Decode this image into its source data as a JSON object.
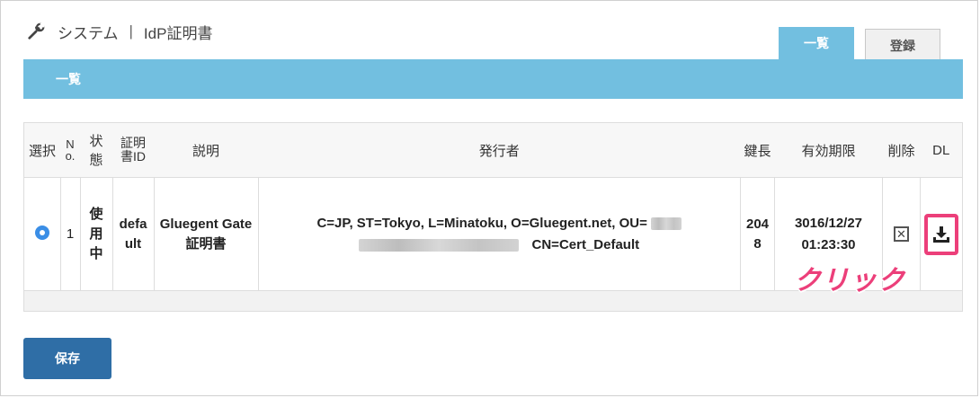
{
  "header": {
    "section": "システム",
    "separator": "|",
    "title": "IdP証明書"
  },
  "tabs": [
    {
      "label": "一覧"
    },
    {
      "label": "登録"
    }
  ],
  "section_bar": {
    "title": "一覧"
  },
  "table": {
    "headers": {
      "select": "選択",
      "no": "N o.",
      "status": "状態",
      "cert_id": "証明書ID",
      "description": "説明",
      "issuer": "発行者",
      "key_length": "鍵長",
      "expiry": "有効期限",
      "delete": "削除",
      "dl": "DL"
    },
    "rows": [
      {
        "no": "1",
        "status": "使用中",
        "cert_id": "default",
        "description": "Gluegent Gate 証明書",
        "issuer_line1": "C=JP, ST=Tokyo, L=Minatoku, O=Gluegent.net, OU=",
        "issuer_line2": "CN=Cert_Default",
        "key_length": "2048",
        "expiry_date": "3016/12/27",
        "expiry_time": "01:23:30"
      }
    ]
  },
  "annotation": {
    "text": "クリック",
    "color": "#ec3f7a"
  },
  "buttons": {
    "save": "保存"
  },
  "colors": {
    "accent": "#72bfe0",
    "primary_button": "#2f6ea6",
    "radio": "#3a8ee6"
  },
  "icons": {
    "header": "wrench-icon",
    "delete": "delete-checkbox-icon",
    "download": "download-icon"
  }
}
